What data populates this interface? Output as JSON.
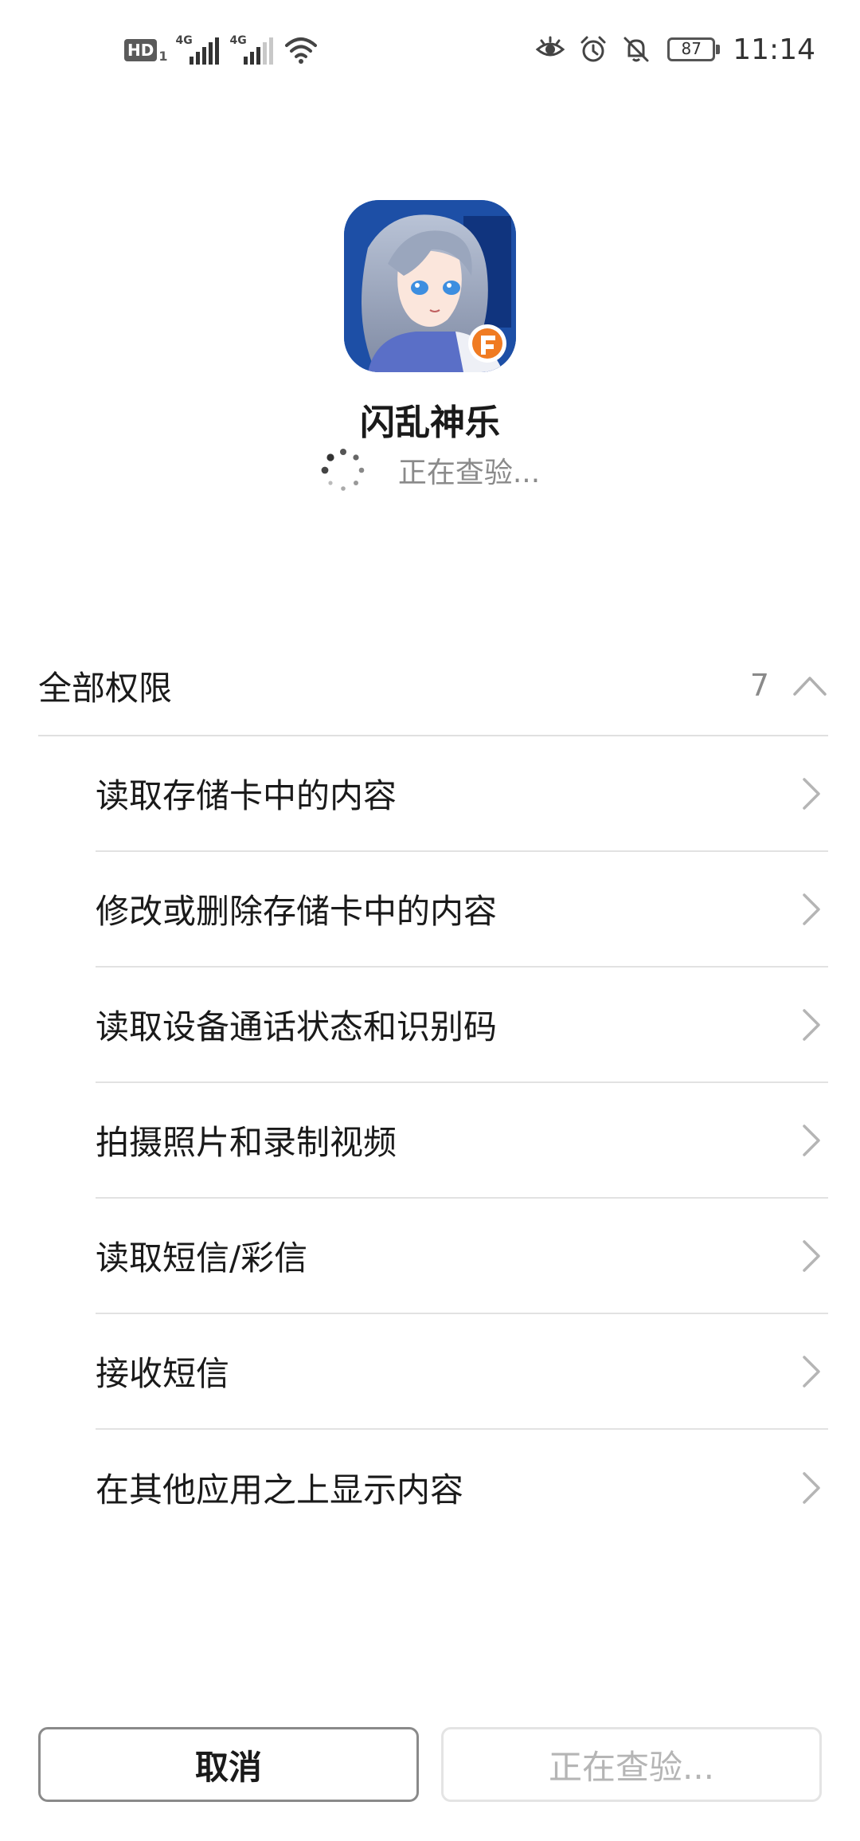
{
  "status_bar": {
    "hd_label": "HD",
    "hd_sub": "1",
    "network1": "4G",
    "network2": "4G",
    "battery": "87",
    "time": "11:14"
  },
  "app": {
    "name": "闪乱神乐",
    "status": "正在查验..."
  },
  "permissions": {
    "title": "全部权限",
    "count": "7",
    "items": [
      {
        "label": "读取存储卡中的内容"
      },
      {
        "label": "修改或删除存储卡中的内容"
      },
      {
        "label": "读取设备通话状态和识别码"
      },
      {
        "label": "拍摄照片和录制视频"
      },
      {
        "label": "读取短信/彩信"
      },
      {
        "label": "接收短信"
      },
      {
        "label": "在其他应用之上显示内容"
      }
    ]
  },
  "buttons": {
    "cancel": "取消",
    "install": "正在查验..."
  },
  "colors": {
    "accent_disabled": "#b5b5b5",
    "divider": "#e2e2e2",
    "secondary_text": "#8a8a8a"
  }
}
